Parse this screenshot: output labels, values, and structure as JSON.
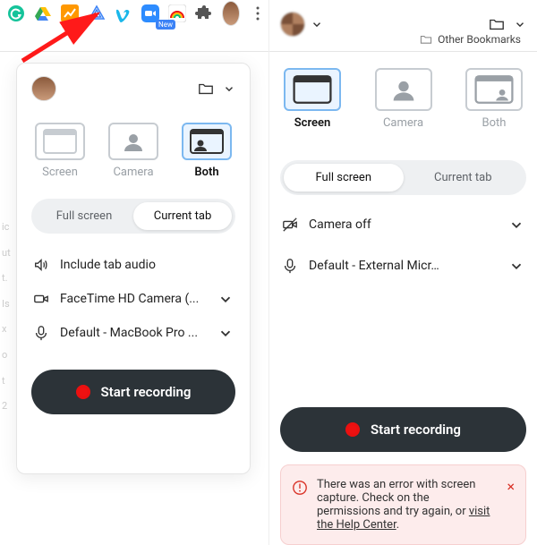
{
  "toolbar": {
    "icons": [
      "grammarly",
      "google-drive",
      "analytics",
      "archive",
      "vimeo",
      "zoom",
      "rainbow-ext",
      "puzzle",
      "avatar",
      "more"
    ],
    "bookmark_label": "Other Bookmarks",
    "new_badge": "New"
  },
  "left_panel": {
    "modes": [
      {
        "label": "Screen",
        "selected": false
      },
      {
        "label": "Camera",
        "selected": false
      },
      {
        "label": "Both",
        "selected": true
      }
    ],
    "segment": {
      "options": [
        "Full screen",
        "Current tab"
      ],
      "active": 1
    },
    "audio_label": "Include tab audio",
    "camera_label": "FaceTime HD Camera (...",
    "mic_label": "Default - MacBook Pro ...",
    "record_label": "Start recording"
  },
  "right_panel": {
    "modes": [
      {
        "label": "Screen",
        "selected": true
      },
      {
        "label": "Camera",
        "selected": false
      },
      {
        "label": "Both",
        "selected": false
      }
    ],
    "segment": {
      "options": [
        "Full screen",
        "Current tab"
      ],
      "active": 0
    },
    "camera_label": "Camera off",
    "mic_label": "Default - External Micr…",
    "record_label": "Start recording",
    "error": {
      "text_before": "There was an error with screen capture. Check on the permissions and try again, or ",
      "link": "visit the Help Center",
      "text_after": "."
    }
  }
}
